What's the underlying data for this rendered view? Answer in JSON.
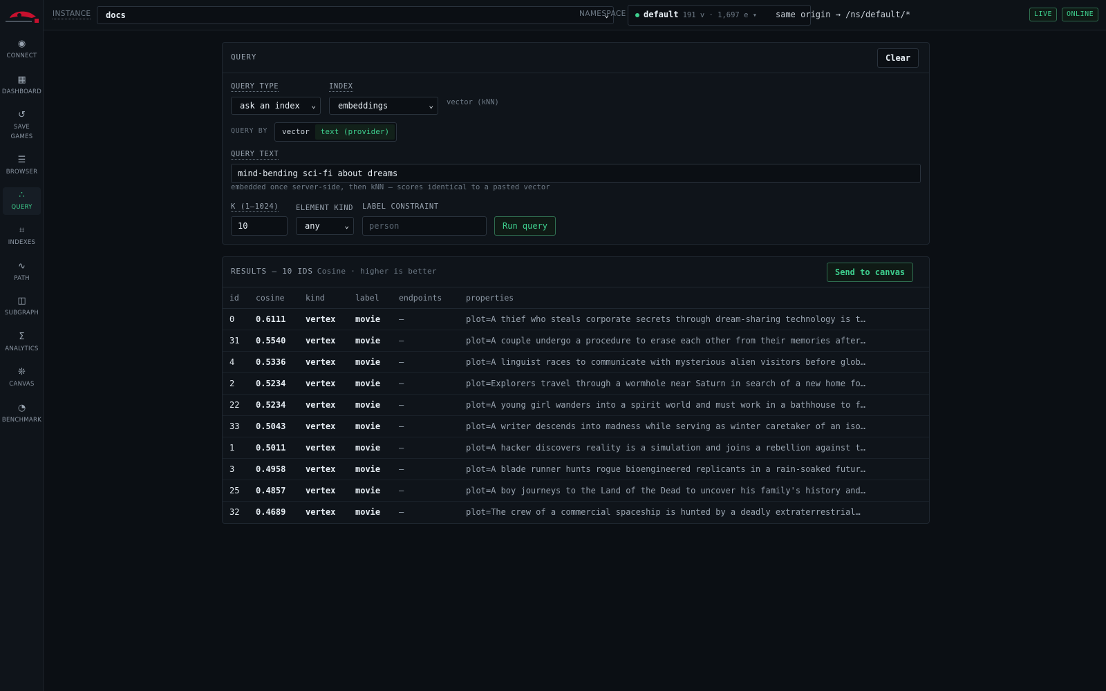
{
  "brand": {
    "accent": "#3ecf8e",
    "logo_color": "#c8102e"
  },
  "sidebar": {
    "items": [
      {
        "label": "CONNECT",
        "icon": "target-icon",
        "glyph": "◉"
      },
      {
        "label": "DASHBOARD",
        "icon": "dashboard-icon",
        "glyph": "▦"
      },
      {
        "label": "SAVE GAMES",
        "icon": "refresh-icon",
        "glyph": "↺"
      },
      {
        "label": "BROWSER",
        "icon": "list-icon",
        "glyph": "☰"
      },
      {
        "label": "QUERY",
        "icon": "dots-icon",
        "glyph": "∴"
      },
      {
        "label": "INDEXES",
        "icon": "frame-icon",
        "glyph": "⌗"
      },
      {
        "label": "PATH",
        "icon": "path-icon",
        "glyph": "∿"
      },
      {
        "label": "SUBGRAPH",
        "icon": "columns-icon",
        "glyph": "◫"
      },
      {
        "label": "ANALYTICS",
        "icon": "sigma-icon",
        "glyph": "Σ"
      },
      {
        "label": "CANVAS",
        "icon": "network-icon",
        "glyph": "❊"
      },
      {
        "label": "BENCHMARK",
        "icon": "gauge-icon",
        "glyph": "◔"
      }
    ]
  },
  "topbar": {
    "instance_label": "INSTANCE",
    "instance_value": "docs",
    "namespace_label": "NAMESPACE",
    "namespace_name": "default",
    "namespace_stats": "191 v · 1,697 e ▾",
    "origin": "same origin → /ns/default/*",
    "badge_live": "LIVE",
    "badge_online": "ONLINE"
  },
  "query_panel": {
    "title": "QUERY",
    "clear_label": "Clear",
    "query_type_label": "QUERY TYPE",
    "query_type_value": "ask an index",
    "index_label": "INDEX",
    "index_value": "embeddings",
    "index_hint": "vector (kNN)",
    "query_by_label": "QUERY BY",
    "query_by_options": [
      "vector",
      "text (provider)"
    ],
    "query_text_label": "QUERY TEXT",
    "query_text_value": "mind-bending sci-fi about dreams",
    "query_text_hint": "embedded once server-side, then kNN — scores identical to a pasted vector",
    "k_label": "K (1–1024)",
    "k_value": "10",
    "element_kind_label": "ELEMENT KIND",
    "element_kind_value": "any",
    "label_constraint_label": "LABEL CONSTRAINT",
    "label_constraint_placeholder": "person",
    "run_label": "Run query"
  },
  "results_panel": {
    "title": "RESULTS — 10 IDS",
    "meta": "Cosine · higher is better",
    "send_label": "Send to canvas",
    "columns": [
      "id",
      "cosine",
      "kind",
      "label",
      "endpoints",
      "properties"
    ],
    "rows": [
      [
        "0",
        "0.6111",
        "vertex",
        "movie",
        "—",
        "plot=A thief who steals corporate secrets through dream-sharing technology is t…"
      ],
      [
        "31",
        "0.5540",
        "vertex",
        "movie",
        "—",
        "plot=A couple undergo a procedure to erase each other from their memories after…"
      ],
      [
        "4",
        "0.5336",
        "vertex",
        "movie",
        "—",
        "plot=A linguist races to communicate with mysterious alien visitors before glob…"
      ],
      [
        "2",
        "0.5234",
        "vertex",
        "movie",
        "—",
        "plot=Explorers travel through a wormhole near Saturn in search of a new home fo…"
      ],
      [
        "22",
        "0.5234",
        "vertex",
        "movie",
        "—",
        "plot=A young girl wanders into a spirit world and must work in a bathhouse to f…"
      ],
      [
        "33",
        "0.5043",
        "vertex",
        "movie",
        "—",
        "plot=A writer descends into madness while serving as winter caretaker of an iso…"
      ],
      [
        "1",
        "0.5011",
        "vertex",
        "movie",
        "—",
        "plot=A hacker discovers reality is a simulation and joins a rebellion against t…"
      ],
      [
        "3",
        "0.4958",
        "vertex",
        "movie",
        "—",
        "plot=A blade runner hunts rogue bioengineered replicants in a rain-soaked futur…"
      ],
      [
        "25",
        "0.4857",
        "vertex",
        "movie",
        "—",
        "plot=A boy journeys to the Land of the Dead to uncover his family's history and…"
      ],
      [
        "32",
        "0.4689",
        "vertex",
        "movie",
        "—",
        "plot=The crew of a commercial spaceship is hunted by a deadly extraterrestrial…"
      ]
    ]
  }
}
